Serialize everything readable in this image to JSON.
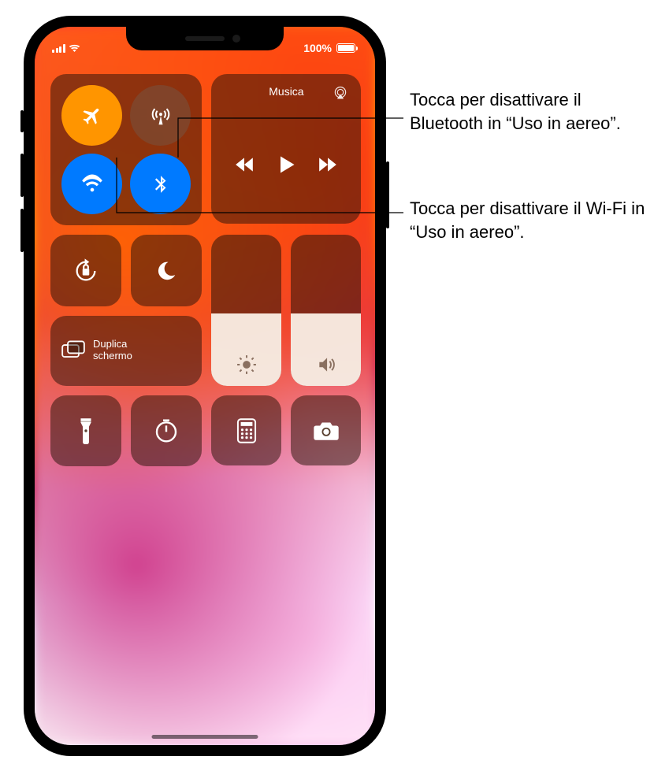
{
  "status": {
    "battery_text": "100%"
  },
  "connectivity": {
    "airplane": {
      "name": "airplane-mode-toggle",
      "active": true
    },
    "cellular": {
      "name": "cellular-data-toggle",
      "active": false
    },
    "wifi": {
      "name": "wifi-toggle",
      "active": true
    },
    "bluetooth": {
      "name": "bluetooth-toggle",
      "active": true
    }
  },
  "music": {
    "title": "Musica"
  },
  "mirror": {
    "label": "Duplica\nschermo"
  },
  "sliders": {
    "brightness_pct": 48,
    "volume_pct": 48
  },
  "callouts": {
    "bluetooth": "Tocca per disattivare il Bluetooth in “Uso in aereo”.",
    "wifi": "Tocca per disattivare il Wi-Fi in “Uso in aereo”."
  }
}
